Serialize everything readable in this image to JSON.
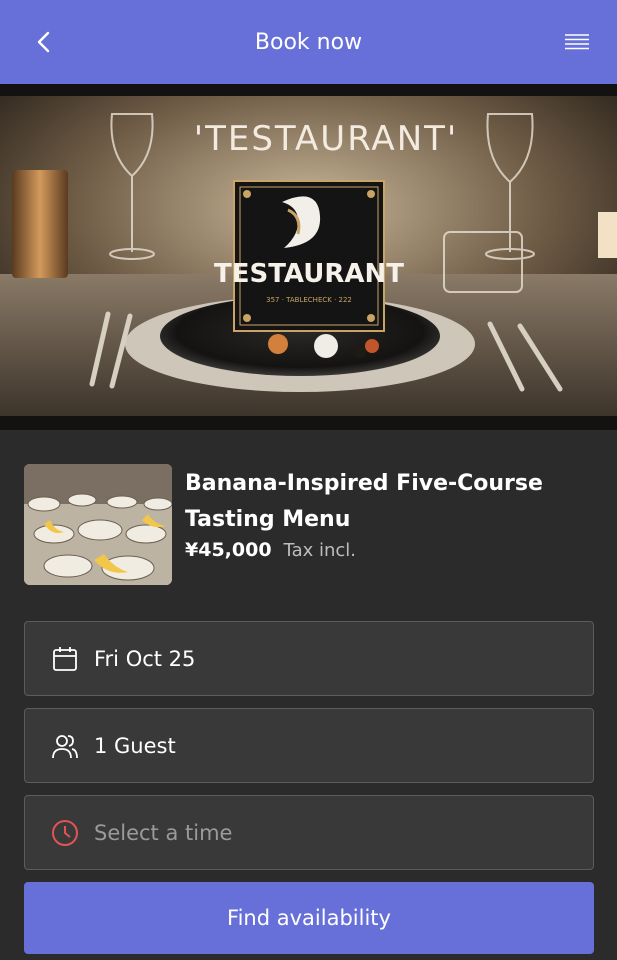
{
  "header": {
    "title": "Book now",
    "back_icon": "chevron-left-icon",
    "menu_icon": "hamburger-menu-icon"
  },
  "hero": {
    "headline": "'TESTAURANT'",
    "logo_name": "TESTAURANT",
    "logo_subtext": "357 · TABLECHECK · 222"
  },
  "menu_item": {
    "name": "Banana-Inspired Five-Course Tasting Menu",
    "price": "¥45,000",
    "tax_note": "Tax incl."
  },
  "fields": {
    "date": {
      "icon": "calendar-icon",
      "value": "Fri Oct 25"
    },
    "guests": {
      "icon": "guests-icon",
      "value": "1 Guest"
    },
    "time": {
      "icon": "clock-icon",
      "placeholder": "Select a time",
      "icon_color": "#e05454"
    }
  },
  "cta": {
    "label": "Find availability"
  },
  "colors": {
    "accent": "#6670d8",
    "background": "#2b2b2b",
    "field_bg": "#393939"
  }
}
